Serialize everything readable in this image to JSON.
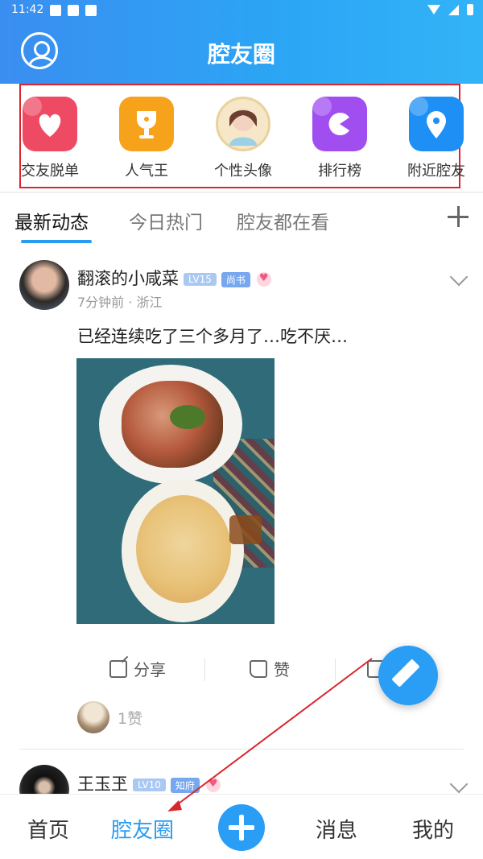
{
  "status_bar": {
    "time": "11:42"
  },
  "header": {
    "title": "腔友圈"
  },
  "quick_entries": [
    {
      "label": "交友脱单",
      "icon": "heart-icon",
      "color": "#ef4a63"
    },
    {
      "label": "人气王",
      "icon": "trophy-icon",
      "color": "#f6a21b"
    },
    {
      "label": "个性头像",
      "icon": "portrait-avatar-icon",
      "color": "#f5e7c7"
    },
    {
      "label": "排行榜",
      "icon": "pacman-icon",
      "color": "#a04ef0"
    },
    {
      "label": "附近腔友",
      "icon": "location-pin-icon",
      "color": "#1e8ff4"
    }
  ],
  "tabs": [
    {
      "label": "最新动态",
      "active": true
    },
    {
      "label": "今日热门",
      "active": false
    },
    {
      "label": "腔友都在看",
      "active": false
    }
  ],
  "post1": {
    "author": "翻滚的小咸菜",
    "level": "LV15",
    "rank": "尚书",
    "meta": "7分钟前 · 浙江",
    "text": "已经连续吃了三个多月了…吃不厌…",
    "actions": {
      "share": "分享",
      "like": "赞"
    },
    "likes_text": "1赞"
  },
  "post2": {
    "author": "王玉玊",
    "level": "LV10",
    "rank": "知府"
  },
  "bottom_nav": {
    "home": "首页",
    "circle": "腔友圈",
    "messages": "消息",
    "mine": "我的"
  },
  "colors": {
    "accent": "#2a9cf0",
    "highlight_box": "#d9262d"
  }
}
